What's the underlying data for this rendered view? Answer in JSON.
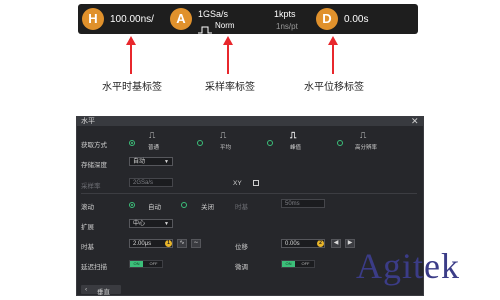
{
  "top_strip": {
    "h_badge": "H",
    "h_value": "100.00ns/",
    "a_badge": "A",
    "a_rate": "1GSa/s",
    "a_mode": "Norm",
    "a_pts": "1kpts",
    "a_pt_time": "1ns/pt",
    "d_badge": "D",
    "d_value": "0.00s"
  },
  "captions": {
    "timebase": "水平时基标签",
    "sample_rate": "采样率标签",
    "offset": "水平位移标签"
  },
  "dialog": {
    "title": "水平",
    "close_icon": "close-icon",
    "acquire_label": "获取方式",
    "acquire_options": [
      "普通",
      "平均",
      "峰值",
      "高分辨率"
    ],
    "acquire_selected": 0,
    "mem_label": "存储深度",
    "mem_value": "自动",
    "srate_label": "采样率",
    "srate_value": "2GSa/s",
    "xy_label": "XY",
    "roll_label": "滚动",
    "roll_auto": "自动",
    "roll_off": "关闭",
    "timebase_label_dim": "时基",
    "timebase_dim_value": "50ms",
    "expand_label": "扩展",
    "expand_value": "中心",
    "tb_label": "时基",
    "tb_value": "2.00μs",
    "offset_label": "位移",
    "offset_value": "0.00s",
    "delay_label": "延迟扫描",
    "delay_on": "ON",
    "delay_off": "OFF",
    "fine_label": "微调",
    "fine_on": "ON",
    "fine_off": "OFF",
    "back_label": "垂直",
    "badge_1": "1",
    "badge_2": "2"
  },
  "brand": "Agitek",
  "colors": {
    "accent_orange": "#e0912c",
    "arrow_red": "#e8272c",
    "toggle_green": "#3cbf7a",
    "brand_blue": "#3b3c87"
  }
}
